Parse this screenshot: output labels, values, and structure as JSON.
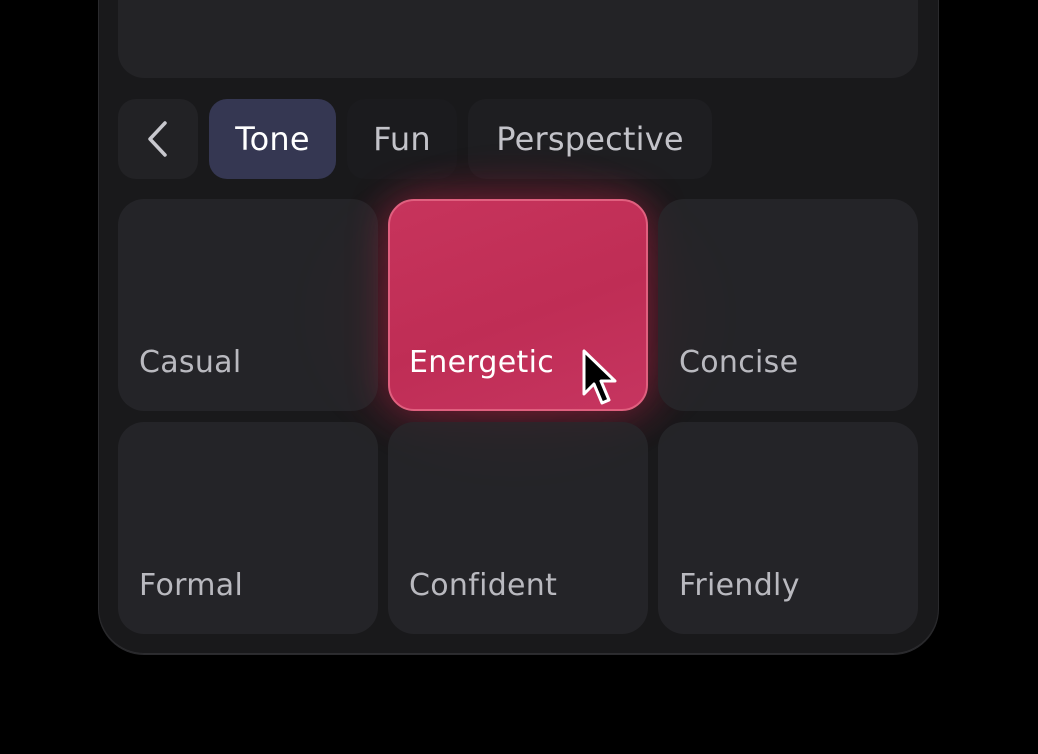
{
  "tabs": {
    "back_icon": "chevron-left-icon",
    "items": [
      {
        "label": "Tone",
        "active": true
      },
      {
        "label": "Fun",
        "active": false
      },
      {
        "label": "Perspective",
        "active": false
      }
    ]
  },
  "options": [
    {
      "label": "Casual",
      "selected": false
    },
    {
      "label": "Energetic",
      "selected": true
    },
    {
      "label": "Concise",
      "selected": false
    },
    {
      "label": "Formal",
      "selected": false
    },
    {
      "label": "Confident",
      "selected": false
    },
    {
      "label": "Friendly",
      "selected": false
    }
  ],
  "colors": {
    "accent": "#c3325a",
    "active_tab": "#353752",
    "background": "#000000",
    "panel": "#19191b"
  }
}
